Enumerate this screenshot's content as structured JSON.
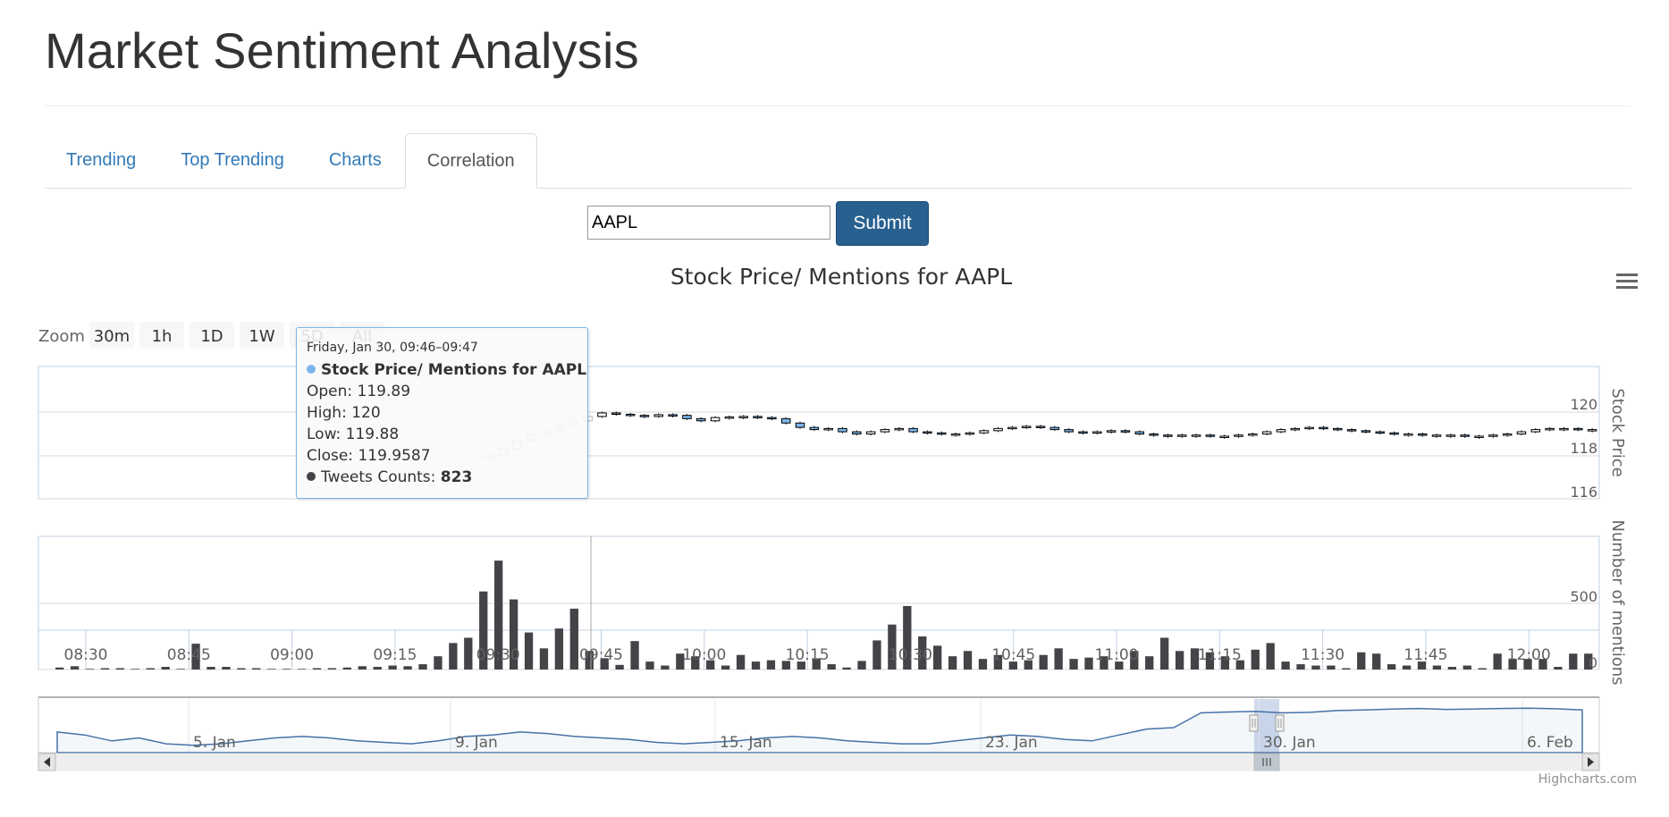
{
  "page": {
    "title": "Market Sentiment Analysis"
  },
  "tabs": [
    {
      "label": "Trending",
      "active": false
    },
    {
      "label": "Top Trending",
      "active": false
    },
    {
      "label": "Charts",
      "active": false
    },
    {
      "label": "Correlation",
      "active": true
    }
  ],
  "search": {
    "value": "AAPL",
    "submit_label": "Submit"
  },
  "menu_icon": "hamburger-icon",
  "zoom": {
    "label": "Zoom",
    "buttons": [
      "30m",
      "1h",
      "1D",
      "1W",
      "5D",
      "All"
    ]
  },
  "tooltip": {
    "header": "Friday, Jan 30, 09:46–09:47",
    "series_name": "Stock Price/ Mentions for AAPL",
    "open": "Open: 119.89",
    "high": "High: 120",
    "low": "Low: 119.88",
    "close": "Close: 119.9587",
    "tweets_label": "Tweets Counts: ",
    "tweets_value": "823",
    "price_color": "#7cb5ec",
    "count_color": "#434348"
  },
  "credits": "Highcharts.com",
  "colors": {
    "accent": "#337ab7",
    "button": "#286090",
    "bars": "#434348",
    "navigator_line": "#4572a7"
  },
  "chart_data": {
    "title": "Stock Price/ Mentions for AAPL",
    "type": "candlestick+bar",
    "x_ticks": [
      "08:30",
      "08:45",
      "09:00",
      "09:15",
      "09:30",
      "09:45",
      "10:00",
      "10:15",
      "10:30",
      "10:45",
      "11:00",
      "11:15",
      "11:30",
      "11:45",
      "12:00"
    ],
    "price_axis": {
      "title": "Stock Price",
      "ticks": [
        120,
        118,
        116
      ],
      "ylim": [
        115,
        122
      ]
    },
    "mentions_axis": {
      "title": "Number of mentions",
      "ticks": [
        500,
        0
      ],
      "ylim": [
        0,
        1000
      ]
    },
    "price_series": {
      "name": "Stock Price/ Mentions for AAPL",
      "closes": [
        118.0,
        118.3,
        118.7,
        119.0,
        119.2,
        119.4,
        119.6,
        119.8,
        119.96,
        119.9,
        119.85,
        119.8,
        119.88,
        119.85,
        119.7,
        119.6,
        119.75,
        119.78,
        119.8,
        119.75,
        119.7,
        119.5,
        119.3,
        119.2,
        119.25,
        119.1,
        119.0,
        119.1,
        119.2,
        119.25,
        119.1,
        119.05,
        119.0,
        119.0,
        119.05,
        119.15,
        119.25,
        119.3,
        119.35,
        119.3,
        119.2,
        119.1,
        119.05,
        119.1,
        119.15,
        119.1,
        119.0,
        118.95,
        118.9,
        118.95,
        118.95,
        118.9,
        118.9,
        118.95,
        119.0,
        119.1,
        119.2,
        119.25,
        119.3,
        119.25,
        119.2,
        119.15,
        119.1,
        119.05,
        119.0,
        119.0,
        118.95,
        118.95,
        118.95,
        118.9,
        118.9,
        118.95,
        119.0,
        119.1,
        119.2,
        119.25,
        119.25,
        119.2,
        119.2
      ]
    },
    "mentions_series": {
      "name": "Tweets Counts",
      "values": [
        15,
        25,
        5,
        10,
        10,
        5,
        10,
        20,
        5,
        195,
        20,
        20,
        10,
        10,
        5,
        5,
        5,
        10,
        10,
        15,
        25,
        20,
        30,
        25,
        40,
        100,
        200,
        240,
        590,
        823,
        530,
        280,
        160,
        310,
        460,
        140,
        85,
        35,
        215,
        60,
        30,
        120,
        100,
        70,
        30,
        110,
        60,
        70,
        65,
        60,
        85,
        40,
        15,
        65,
        220,
        340,
        480,
        250,
        180,
        100,
        140,
        80,
        110,
        60,
        70,
        110,
        160,
        80,
        90,
        100,
        60,
        140,
        100,
        240,
        140,
        160,
        130,
        100,
        70,
        150,
        200,
        60,
        40,
        30,
        30,
        10,
        130,
        120,
        40,
        30,
        60,
        30,
        20,
        30,
        10,
        120,
        80,
        80,
        80,
        20,
        120,
        120
      ]
    },
    "navigator": {
      "x_ticks": [
        "5. Jan",
        "9. Jan",
        "15. Jan",
        "23. Jan",
        "30. Jan",
        "6. Feb"
      ],
      "values": [
        112,
        111,
        109,
        110,
        108,
        107.5,
        108,
        109,
        110,
        110.5,
        110,
        109,
        108.5,
        108,
        109,
        110.5,
        111,
        112,
        111.5,
        110.5,
        110,
        109.5,
        108.5,
        108,
        108.5,
        109,
        110,
        110.5,
        110,
        109,
        108.5,
        108,
        108,
        109,
        110,
        111,
        110.5,
        109.5,
        109,
        111,
        113,
        113.5,
        118.5,
        118.8,
        119,
        118.5,
        118.7,
        119.3,
        119.5,
        119.8,
        120,
        119.7,
        119.8,
        120,
        120.1,
        119.9,
        119.5
      ]
    }
  }
}
